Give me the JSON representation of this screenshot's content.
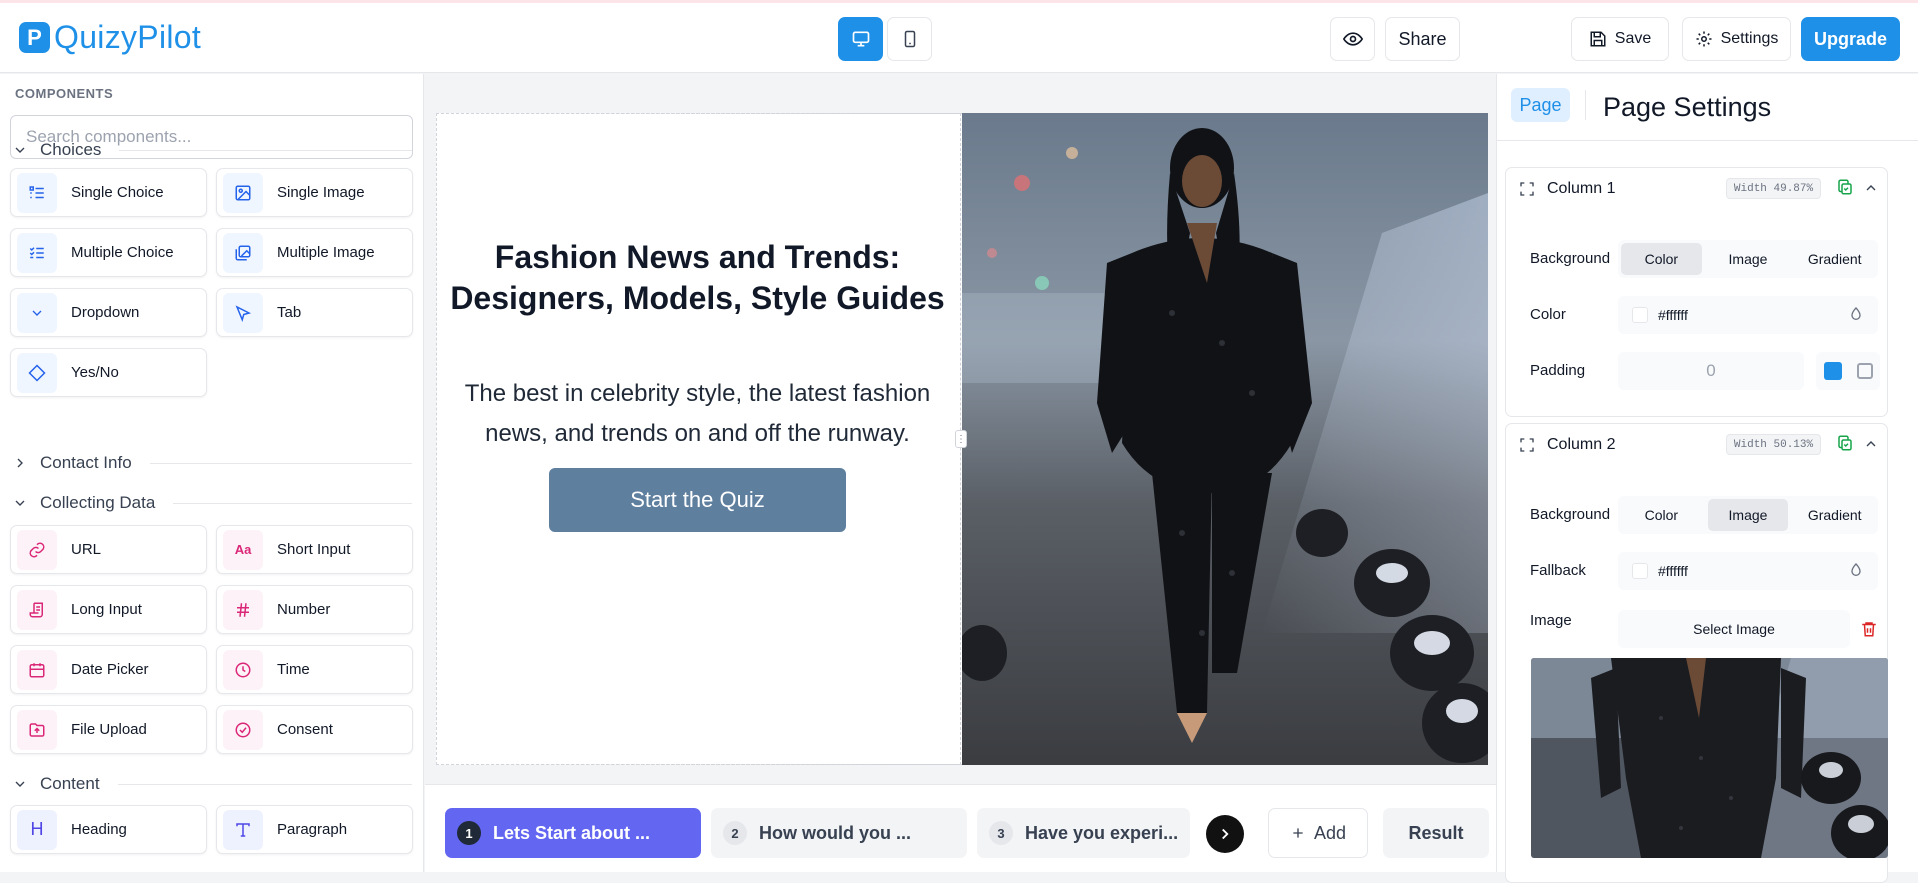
{
  "header": {
    "logo_text": "QuizyPilot",
    "logo_letter": "P",
    "share_label": "Share",
    "save_label": "Save",
    "settings_label": "Settings",
    "upgrade_label": "Upgrade"
  },
  "sidebar": {
    "title": "COMPONENTS",
    "search_placeholder": "Search components...",
    "sections": {
      "choices": "Choices",
      "contact": "Contact Info",
      "collecting": "Collecting Data",
      "content": "Content"
    },
    "items": {
      "single_choice": "Single Choice",
      "single_image": "Single Image",
      "multiple_choice": "Multiple Choice",
      "multiple_image": "Multiple Image",
      "dropdown": "Dropdown",
      "tab": "Tab",
      "yes_no": "Yes/No",
      "url": "URL",
      "short_input": "Short Input",
      "long_input": "Long Input",
      "number": "Number",
      "date_picker": "Date Picker",
      "time": "Time",
      "file_upload": "File Upload",
      "consent": "Consent",
      "heading": "Heading",
      "paragraph": "Paragraph"
    }
  },
  "canvas": {
    "title": "Fashion News and Trends: Designers, Models, Style Guides",
    "subtitle": "The best in celebrity style, the latest fashion news, and trends on and off the runway.",
    "start_button": "Start the Quiz"
  },
  "pages": {
    "tabs": [
      {
        "num": "1",
        "label": "Lets Start about ..."
      },
      {
        "num": "2",
        "label": "How would you ..."
      },
      {
        "num": "3",
        "label": "Have you experi..."
      }
    ],
    "add_label": "Add",
    "result_label": "Result"
  },
  "right_panel": {
    "page_tab": "Page",
    "title": "Page Settings",
    "column1": {
      "title": "Column 1",
      "width": "Width 49.87%",
      "background_label": "Background",
      "bg_options": [
        "Color",
        "Image",
        "Gradient"
      ],
      "color_label": "Color",
      "color_value": "#ffffff",
      "padding_label": "Padding",
      "padding_value": "0"
    },
    "column2": {
      "title": "Column 2",
      "width": "Width 50.13%",
      "background_label": "Background",
      "bg_options": [
        "Color",
        "Image",
        "Gradient"
      ],
      "fallback_label": "Fallback",
      "fallback_value": "#ffffff",
      "image_label": "Image",
      "select_image": "Select Image"
    }
  },
  "colors": {
    "brand": "#1e90e8",
    "active_page": "#6366f1",
    "start_button": "#5f7f9f"
  }
}
